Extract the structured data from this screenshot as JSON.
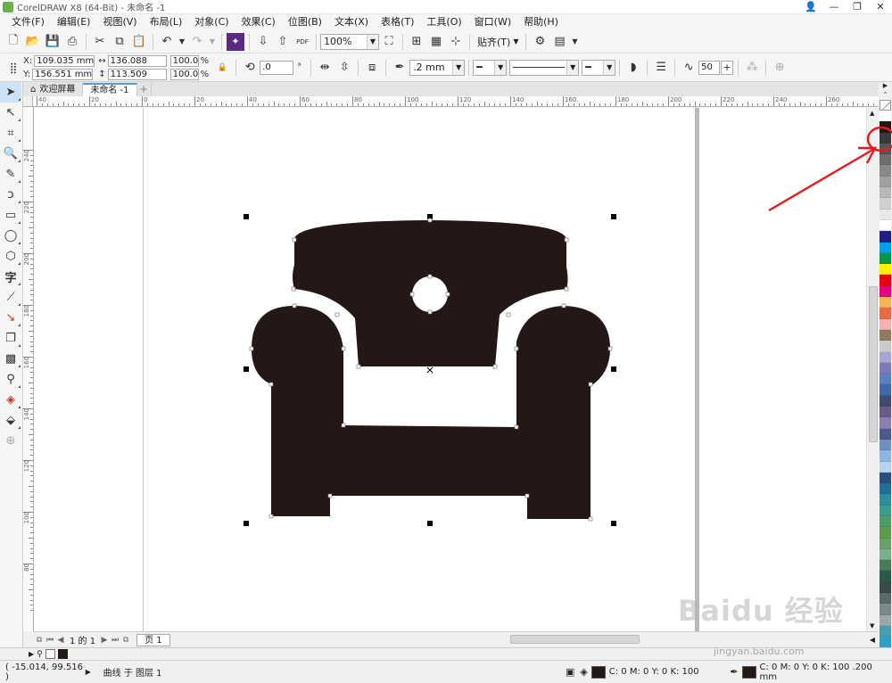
{
  "window": {
    "title": "CorelDRAW X8 (64-Bit) - 未命名 -1",
    "controls": [
      "👤",
      "—",
      "❐",
      "✕"
    ]
  },
  "menu": [
    "文件(F)",
    "编辑(E)",
    "视图(V)",
    "布局(L)",
    "对象(C)",
    "效果(C)",
    "位图(B)",
    "文本(X)",
    "表格(T)",
    "工具(O)",
    "窗口(W)",
    "帮助(H)"
  ],
  "toolbar": {
    "zoom": "100%",
    "snap": "贴齐(T)",
    "pdf_label": "PDF"
  },
  "properties": {
    "x": "109.035 mm",
    "y": "156.551 mm",
    "width": "136.088 mm",
    "height": "113.509 mm",
    "scale_x": "100.0",
    "scale_y": "100.0",
    "percent": "%",
    "rotation": ".0",
    "rotation_unit": "°",
    "outline_width": ".2 mm",
    "smooth": "50",
    "x_label": "X:",
    "y_label": "Y:"
  },
  "tabs": [
    {
      "label": "欢迎屏幕",
      "active": false
    },
    {
      "label": "未命名 -1",
      "active": true
    }
  ],
  "ruler": {
    "top": [
      "40",
      "20",
      "0",
      "20",
      "40",
      "60",
      "80",
      "100",
      "120",
      "140",
      "160",
      "180",
      "200",
      "220",
      "240",
      "260"
    ],
    "left": [
      "240",
      "220",
      "200",
      "180",
      "160",
      "140",
      "120",
      "100",
      "80"
    ]
  },
  "pagenav": {
    "position": "1 的 1",
    "page_tab": "页 1"
  },
  "status": {
    "coords": "( -15.014, 99.516 )",
    "object": "曲线 于 图层 1",
    "fill": "C: 0 M: 0 Y: 0 K: 100",
    "outline": "C: 0 M: 0 Y: 0 K: 100  .200 mm"
  },
  "palette": [
    "#ffffff",
    "#231815",
    "#3a3a3a",
    "#555555",
    "#6e6e6e",
    "#888888",
    "#a0a0a0",
    "#b8b8b8",
    "#d0d0d0",
    "#e8e8e8",
    "#ffffff",
    "#1d2088",
    "#00a0e9",
    "#009944",
    "#fff100",
    "#e60012",
    "#e4007f",
    "#f8b551",
    "#ec6941",
    "#f5b2b2",
    "#8f7a5c",
    "#c9caca",
    "#a7a5d1",
    "#7d7ab6",
    "#5c7fbd",
    "#3f69a8",
    "#3e4c6e",
    "#6a5c86",
    "#8b7fb0",
    "#4a5a8a",
    "#6e8fbf",
    "#8fb6e0",
    "#b7d3ee",
    "#2b4f7a",
    "#1f6f9a",
    "#2f8c9a",
    "#3c9c8c",
    "#4c9c6c",
    "#5c9c4c",
    "#6aa06a",
    "#7ab08a",
    "#4a7a5a",
    "#2a5a4a",
    "#3a4a4a",
    "#5a6a6a",
    "#7a8a8a",
    "#9aaaaa",
    "#46a0b0",
    "#2ea0c8",
    "#1a8cc0"
  ],
  "colors": {
    "object_fill": "#231815",
    "annotation": "#e8191e",
    "accent": "#5b9bd5"
  },
  "watermark": {
    "brand": "Baidu 经验",
    "url": "jingyan.baidu.com"
  }
}
